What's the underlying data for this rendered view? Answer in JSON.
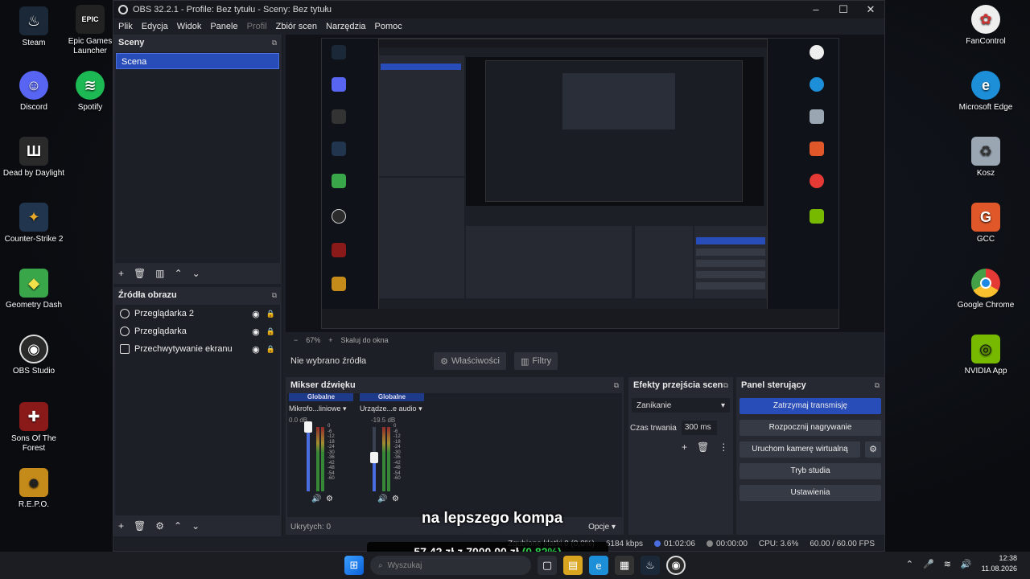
{
  "desktop": {
    "left_icons": [
      {
        "label": "Steam",
        "icon": "steam-icon",
        "color": "#1b2838"
      },
      {
        "label": "Discord",
        "icon": "discord-icon",
        "color": "#5865f2"
      },
      {
        "label": "Dead by Daylight",
        "icon": "dbd-icon",
        "color": "#2a2a2a"
      },
      {
        "label": "Counter-Strike 2",
        "icon": "cs2-icon",
        "color": "#22354f"
      },
      {
        "label": "Geometry Dash",
        "icon": "gd-icon",
        "color": "#3aa64a"
      },
      {
        "label": "OBS Studio",
        "icon": "obs-icon",
        "color": "#2b2b2b"
      },
      {
        "label": "Sons Of The Forest",
        "icon": "sotf-icon",
        "color": "#8a1a1a"
      },
      {
        "label": "R.E.P.O.",
        "icon": "repo-icon",
        "color": "#c48a1a"
      }
    ],
    "second_col_icons": [
      {
        "label": "Epic Games Launcher",
        "icon": "epic-icon",
        "color": "#222222"
      },
      {
        "label": "Spotify",
        "icon": "spotify-icon",
        "color": "#1db954"
      }
    ],
    "right_icons": [
      {
        "label": "FanControl",
        "icon": "fancontrol-icon",
        "color": "#eeeeee"
      },
      {
        "label": "Microsoft Edge",
        "icon": "edge-icon",
        "color": "#1d8fd8"
      },
      {
        "label": "Kosz",
        "icon": "recycle-bin-icon",
        "color": "#9aa6b2"
      },
      {
        "label": "GCC",
        "icon": "gcc-icon",
        "color": "#e0582a"
      },
      {
        "label": "Google Chrome",
        "icon": "chrome-icon",
        "color": "#e53935"
      },
      {
        "label": "NVIDIA App",
        "icon": "nvidia-icon",
        "color": "#76b900"
      }
    ]
  },
  "obs": {
    "title": "OBS 32.2.1 - Profile: Bez tytułu - Sceny: Bez tytułu",
    "menu": [
      "Plik",
      "Edycja",
      "Widok",
      "Panele",
      "Profil",
      "Zbiór scen",
      "Narzędzia",
      "Pomoc"
    ],
    "scenes": {
      "header": "Sceny",
      "items": [
        "Scena"
      ]
    },
    "sources": {
      "header": "Źródła obrazu",
      "items": [
        {
          "name": "Przeglądarka 2",
          "icon": "browser-source-icon"
        },
        {
          "name": "Przeglądarka",
          "icon": "browser-source-icon"
        },
        {
          "name": "Przechwytywanie ekranu",
          "icon": "monitor-source-icon"
        }
      ]
    },
    "preview_toolbar": {
      "zoom": "67%",
      "fit": "Skaluj do okna"
    },
    "context": {
      "no_source": "Nie wybrano źródła",
      "properties": "Właściwości",
      "filters": "Filtry"
    },
    "mixer": {
      "header": "Mikser dźwięku",
      "channels": [
        {
          "tag": "Globalne",
          "name": "Mikrofo...liniowe",
          "db": "0.0 dB",
          "level": 1.0
        },
        {
          "tag": "Globalne",
          "name": "Urządze...e audio",
          "db": "-19.5 dB",
          "level": 0.52
        }
      ],
      "scale": [
        "0",
        "-6",
        "-12",
        "-18",
        "-24",
        "-30",
        "-36",
        "-42",
        "-48",
        "-54",
        "-60"
      ],
      "hidden": "Ukrytych: 0",
      "options": "Opcje"
    },
    "transitions": {
      "header": "Efekty przejścia scen",
      "selected": "Zanikanie",
      "duration_label": "Czas trwania",
      "duration_value": "300 ms"
    },
    "controls": {
      "header": "Panel sterujący",
      "buttons": [
        "Zatrzymaj transmisję",
        "Rozpocznij nagrywanie",
        "Uruchom kamerę wirtualną",
        "Tryb studia",
        "Ustawienia"
      ]
    },
    "status": {
      "dropped": "Zgubione klatki 0 (0,0%)",
      "kbps": "6184 kbps",
      "stream_time": "01:02:06",
      "rec_time": "00:00:00",
      "cpu": "CPU: 3.6%",
      "fps": "60.00 / 60.00 FPS"
    }
  },
  "overlay": {
    "caption": "na lepszego kompa",
    "price_current": "57,42 zł",
    "price_sep": "z",
    "price_goal": "7000,00 zł",
    "percent": "(0.82%)"
  },
  "taskbar": {
    "search_placeholder": "Wyszukaj",
    "time": "12:38",
    "date": "11.08.2026"
  }
}
